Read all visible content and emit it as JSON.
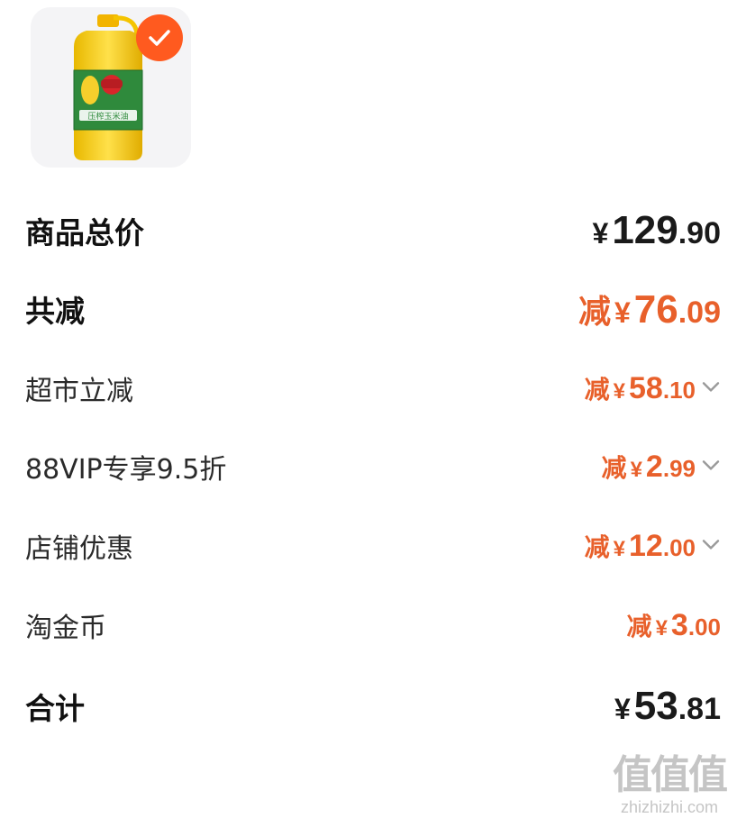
{
  "product": {
    "image_alt": "玉米油",
    "bottle_label": "压榨玉米油"
  },
  "rows": [
    {
      "label": "商品总价",
      "prefix": "",
      "yen": "¥",
      "int": "129",
      "dec": ".90"
    },
    {
      "label": "共减",
      "prefix": "减",
      "yen": "¥",
      "int": "76",
      "dec": ".09"
    },
    {
      "label": "超市立减",
      "prefix": "减",
      "yen": "¥",
      "int": "58",
      "dec": ".10"
    },
    {
      "label": "88VIP专享9.5折",
      "prefix": "减",
      "yen": "¥",
      "int": "2",
      "dec": ".99"
    },
    {
      "label": "店铺优惠",
      "prefix": "减",
      "yen": "¥",
      "int": "12",
      "dec": ".00"
    },
    {
      "label": "淘金币",
      "prefix": "减",
      "yen": "¥",
      "int": "3",
      "dec": ".00"
    },
    {
      "label": "合计",
      "prefix": "",
      "yen": "¥",
      "int": "53",
      "dec": ".81"
    }
  ],
  "watermark": {
    "glyphs": "值值值",
    "url": "zhizhizhi.com"
  },
  "colors": {
    "accent_orange": "#e8602b",
    "check_badge": "#ff5a1f",
    "text": "#1f1f1f"
  },
  "icons": {
    "selected": "check-icon",
    "expand": "chevron-down-icon"
  }
}
